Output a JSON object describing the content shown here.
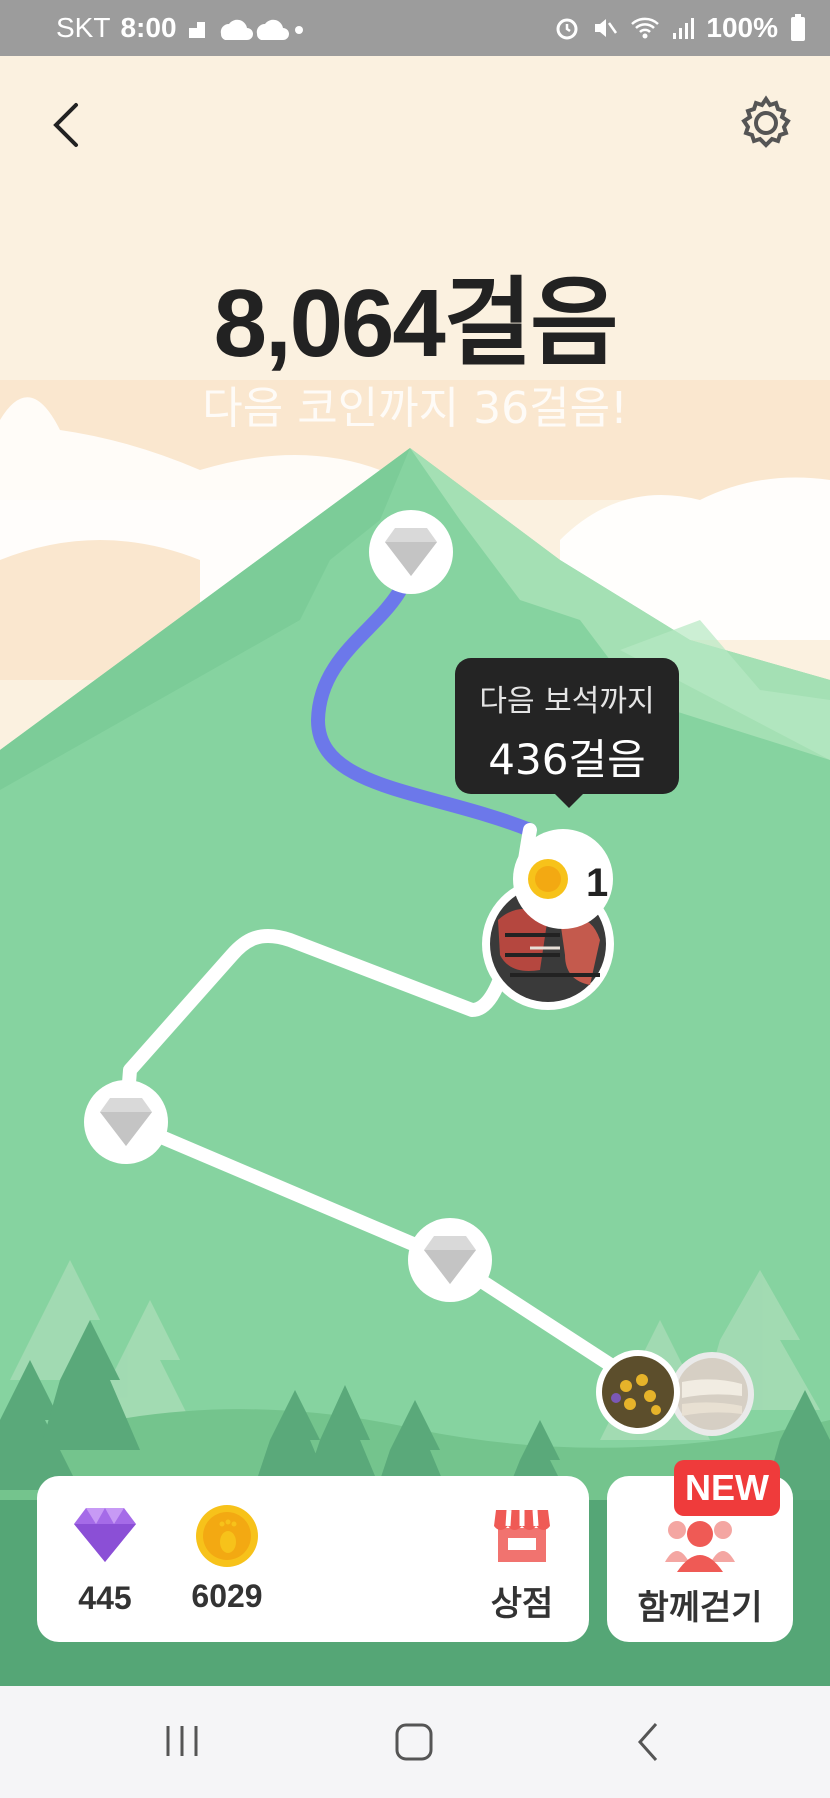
{
  "status": {
    "carrier": "SKT",
    "time": "8:00",
    "battery": "100%"
  },
  "header": {
    "back_icon": "chevron-left-icon",
    "settings_icon": "gear-icon"
  },
  "steps": {
    "total": "8,064걸음",
    "next_coin": "다음 코인까지 36걸음!"
  },
  "tooltip": {
    "line1": "다음 보석까지",
    "line2": "436걸음"
  },
  "coin_badge": {
    "count": "1"
  },
  "wallet": {
    "gems": "445",
    "coins": "6029",
    "shop_label": "상점"
  },
  "walk_together": {
    "badge": "NEW",
    "label": "함께걷기"
  },
  "colors": {
    "mountain": "#86d3a0",
    "path_done": "#6c78ea",
    "gem": "#a56be8",
    "coin": "#f7c21a",
    "badge_red": "#ef3b3b"
  }
}
